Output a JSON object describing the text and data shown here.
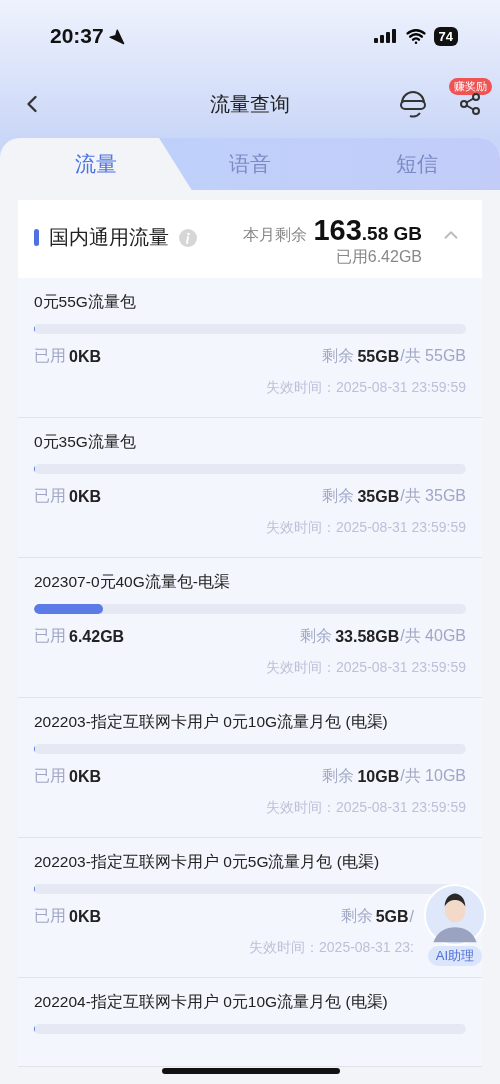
{
  "status_bar": {
    "time": "20:37",
    "battery": "74"
  },
  "nav": {
    "title": "流量查询",
    "badge": "赚奖励"
  },
  "tabs": [
    {
      "label": "流量",
      "selected": true
    },
    {
      "label": "语音",
      "selected": false
    },
    {
      "label": "短信",
      "selected": false
    }
  ],
  "summary": {
    "title": "国内通用流量",
    "remain_label": "本月剩余",
    "remain_int": "163",
    "remain_dec": ".58 GB",
    "used": "已用6.42GB",
    "expanded": true
  },
  "packages": [
    {
      "name": "0元55G流量包",
      "level": 0,
      "used_label": "已用",
      "used": "0KB",
      "remain_label": "剩余",
      "remain": "55GB",
      "total": "/共 55GB",
      "expiry": "失效时间：2025-08-31 23:59:59"
    },
    {
      "name": "0元35G流量包",
      "level": 0,
      "used_label": "已用",
      "used": "0KB",
      "remain_label": "剩余",
      "remain": "35GB",
      "total": "/共 35GB",
      "expiry": "失效时间：2025-08-31 23:59:59"
    },
    {
      "name": "202307-0元40G流量包-电渠",
      "level": 0.16,
      "used_label": "已用",
      "used": "6.42GB",
      "remain_label": "剩余",
      "remain": "33.58GB",
      "total": "/共 40GB",
      "expiry": "失效时间：2025-08-31 23:59:59"
    },
    {
      "name": "202203-指定互联网卡用户 0元10G流量月包 (电渠)",
      "level": 0,
      "used_label": "已用",
      "used": "0KB",
      "remain_label": "剩余",
      "remain": "10GB",
      "total": "/共 10GB",
      "expiry": "失效时间：2025-08-31 23:59:59"
    },
    {
      "name": "202203-指定互联网卡用户 0元5G流量月包 (电渠)",
      "level": 0,
      "used_label": "已用",
      "used": "0KB",
      "remain_label": "剩余",
      "remain": "5GB",
      "total": "/",
      "expiry": "失效时间：2025-08-31 23:",
      "covered": true
    },
    {
      "name": "202204-指定互联网卡用户 0元10G流量月包 (电渠)",
      "level": 0
    }
  ],
  "assistant": {
    "label": "AI助理"
  }
}
